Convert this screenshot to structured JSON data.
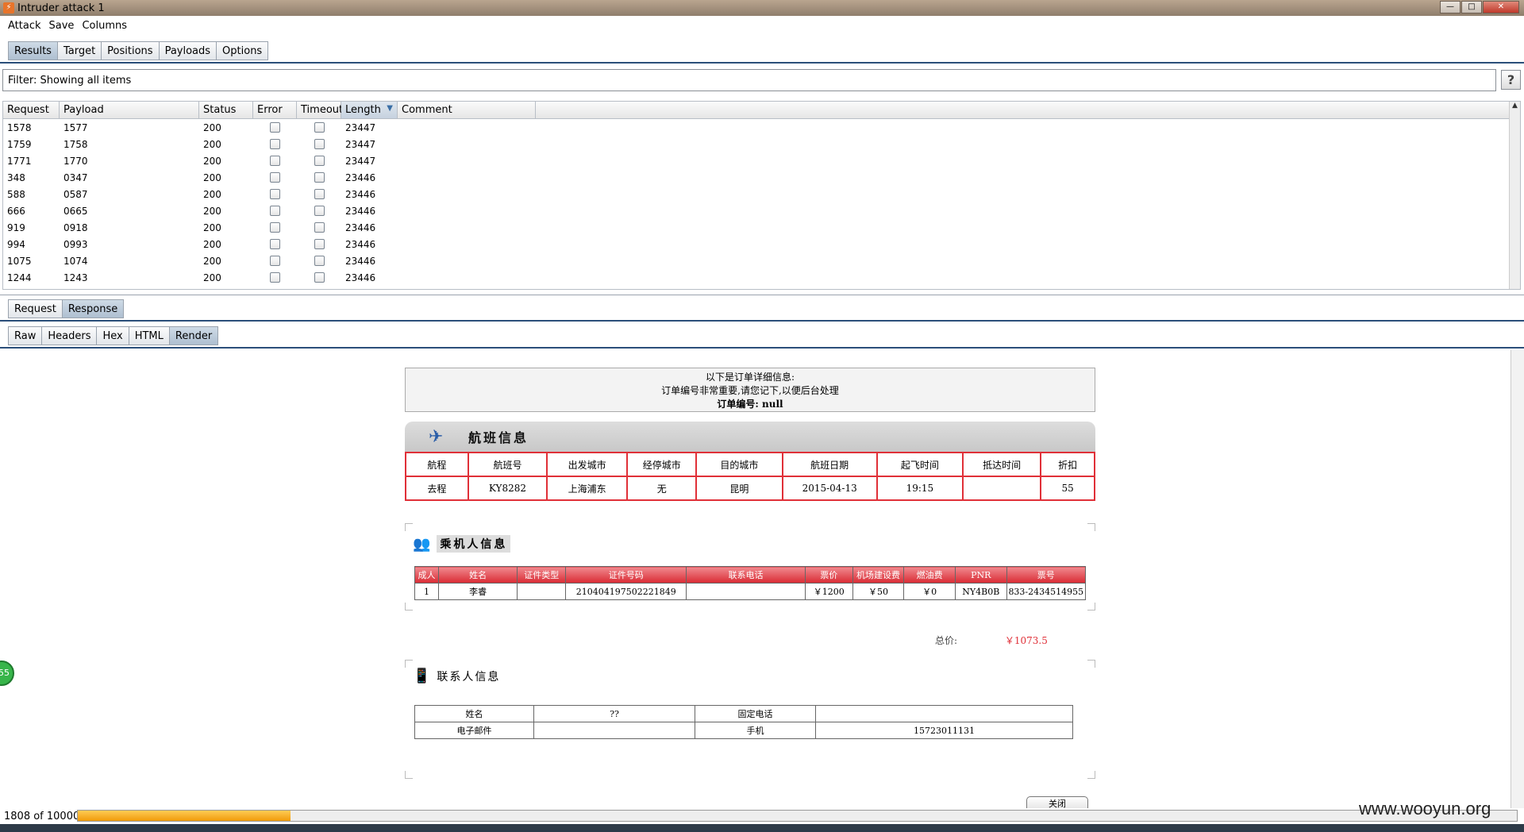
{
  "window": {
    "title": "Intruder attack 1"
  },
  "menu": [
    "Attack",
    "Save",
    "Columns"
  ],
  "main_tabs": [
    "Results",
    "Target",
    "Positions",
    "Payloads",
    "Options"
  ],
  "filter": {
    "text": "Filter: Showing all items",
    "help": "?"
  },
  "table": {
    "columns": [
      "Request",
      "Payload",
      "Status",
      "Error",
      "Timeout",
      "Length",
      "Comment"
    ],
    "rows": [
      [
        "1578",
        "1577",
        "200",
        "23447"
      ],
      [
        "1759",
        "1758",
        "200",
        "23447"
      ],
      [
        "1771",
        "1770",
        "200",
        "23447"
      ],
      [
        "348",
        "0347",
        "200",
        "23446"
      ],
      [
        "588",
        "0587",
        "200",
        "23446"
      ],
      [
        "666",
        "0665",
        "200",
        "23446"
      ],
      [
        "919",
        "0918",
        "200",
        "23446"
      ],
      [
        "994",
        "0993",
        "200",
        "23446"
      ],
      [
        "1075",
        "1074",
        "200",
        "23446"
      ],
      [
        "1244",
        "1243",
        "200",
        "23446"
      ]
    ]
  },
  "req_resp_tabs": [
    "Request",
    "Response"
  ],
  "view_tabs": [
    "Raw",
    "Headers",
    "Hex",
    "HTML",
    "Render"
  ],
  "render": {
    "order_info": [
      "以下是订单详细信息:",
      "订单编号非常重要,请您记下,以便后台处理",
      "订单编号: null"
    ],
    "flight_section_title": "航班信息",
    "flight_headers": [
      "航程",
      "航班号",
      "出发城市",
      "经停城市",
      "目的城市",
      "航班日期",
      "起飞时间",
      "抵达时间",
      "折扣"
    ],
    "flight_row": [
      "去程",
      "KY8282",
      "上海浦东",
      "无",
      "昆明",
      "2015-04-13",
      "19:15",
      "",
      "55"
    ],
    "passenger_section_title": "乘机人信息",
    "passenger_headers": [
      "成人",
      "姓名",
      "证件类型",
      "证件号码",
      "联系电话",
      "票价",
      "机场建设费",
      "燃油费",
      "PNR",
      "票号"
    ],
    "passenger_row": [
      "1",
      "李睿",
      "",
      "210404197502221849",
      "",
      "￥1200",
      "￥50",
      "￥0",
      "NY4B0B",
      "833-2434514955"
    ],
    "total_label": "总价:",
    "total_value": "￥1073.5",
    "contact_section_title": "联系人信息",
    "contact_rows": [
      [
        "姓名",
        "??",
        "固定电话",
        ""
      ],
      [
        "电子邮件",
        "",
        "手机",
        "15723011131"
      ]
    ],
    "close_button": "关闭"
  },
  "status": {
    "count": "1808 of 10000",
    "progress": 0.148
  },
  "watermark": "www.wooyun.org",
  "badge": "55",
  "colors": {
    "accent_red": "#e03038",
    "tab_active": "#aebfd0",
    "progress": "#f09a0a"
  }
}
